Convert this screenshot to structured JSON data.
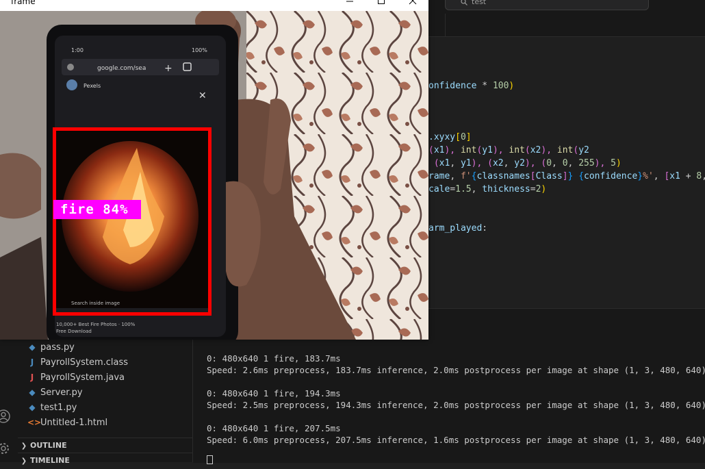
{
  "vscode": {
    "search": {
      "text": "test"
    },
    "code_lines": [
      {
        "segments": [
          {
            "t": "onfidence",
            "c": "var"
          },
          {
            "t": " * ",
            "c": ""
          },
          {
            "t": "100",
            "c": "num"
          },
          {
            "t": ")",
            "c": "brk1"
          }
        ]
      },
      {
        "segments": [
          {
            "t": ".xyxy",
            "c": "var"
          },
          {
            "t": "[",
            "c": "brk1"
          },
          {
            "t": "0",
            "c": "num"
          },
          {
            "t": "]",
            "c": "brk1"
          }
        ]
      },
      {
        "segments": [
          {
            "t": "(",
            "c": "brk2"
          },
          {
            "t": "x1",
            "c": "var"
          },
          {
            "t": "), ",
            "c": "brk2"
          },
          {
            "t": "int",
            "c": "fn"
          },
          {
            "t": "(",
            "c": "brk2"
          },
          {
            "t": "y1",
            "c": "var"
          },
          {
            "t": "), ",
            "c": "brk2"
          },
          {
            "t": "int",
            "c": "fn"
          },
          {
            "t": "(",
            "c": "brk2"
          },
          {
            "t": "x2",
            "c": "var"
          },
          {
            "t": "), ",
            "c": "brk2"
          },
          {
            "t": "int",
            "c": "fn"
          },
          {
            "t": "(",
            "c": "brk2"
          },
          {
            "t": "y2",
            "c": "var"
          }
        ]
      },
      {
        "segments": [
          {
            "t": " (",
            "c": "brk2"
          },
          {
            "t": "x1",
            "c": "var"
          },
          {
            "t": ", ",
            "c": ""
          },
          {
            "t": "y1",
            "c": "var"
          },
          {
            "t": "), ",
            "c": "brk2"
          },
          {
            "t": "(",
            "c": "brk2"
          },
          {
            "t": "x2",
            "c": "var"
          },
          {
            "t": ", ",
            "c": ""
          },
          {
            "t": "y2",
            "c": "var"
          },
          {
            "t": "), ",
            "c": "brk2"
          },
          {
            "t": "(",
            "c": "brk2"
          },
          {
            "t": "0",
            "c": "num"
          },
          {
            "t": ", ",
            "c": ""
          },
          {
            "t": "0",
            "c": "num"
          },
          {
            "t": ", ",
            "c": ""
          },
          {
            "t": "255",
            "c": "num"
          },
          {
            "t": "), ",
            "c": "brk2"
          },
          {
            "t": "5",
            "c": "num"
          },
          {
            "t": ")",
            "c": "brk1"
          }
        ]
      },
      {
        "segments": [
          {
            "t": "rame",
            "c": "var"
          },
          {
            "t": ", ",
            "c": ""
          },
          {
            "t": "f'",
            "c": "str"
          },
          {
            "t": "{",
            "c": "brk3"
          },
          {
            "t": "classnames",
            "c": "var"
          },
          {
            "t": "[",
            "c": "brk2"
          },
          {
            "t": "Class",
            "c": "var"
          },
          {
            "t": "]",
            "c": "brk2"
          },
          {
            "t": "}",
            "c": "brk3"
          },
          {
            "t": " ",
            "c": "str"
          },
          {
            "t": "{",
            "c": "brk3"
          },
          {
            "t": "confidence",
            "c": "var"
          },
          {
            "t": "}",
            "c": "brk3"
          },
          {
            "t": "%'",
            "c": "str"
          },
          {
            "t": ", ",
            "c": ""
          },
          {
            "t": "[",
            "c": "brk2"
          },
          {
            "t": "x1",
            "c": "var"
          },
          {
            "t": " + ",
            "c": ""
          },
          {
            "t": "8",
            "c": "num"
          },
          {
            "t": ",",
            "c": ""
          }
        ]
      },
      {
        "segments": [
          {
            "t": "cale",
            "c": "var"
          },
          {
            "t": "=",
            "c": ""
          },
          {
            "t": "1.5",
            "c": "num"
          },
          {
            "t": ", ",
            "c": ""
          },
          {
            "t": "thickness",
            "c": "var"
          },
          {
            "t": "=",
            "c": ""
          },
          {
            "t": "2",
            "c": "num"
          },
          {
            "t": ")",
            "c": "brk1"
          }
        ]
      },
      {
        "segments": [
          {
            "t": "arm_played",
            "c": "var"
          },
          {
            "t": ":",
            "c": ""
          }
        ]
      }
    ],
    "explorer": {
      "files": [
        {
          "name": "pass.py",
          "icon": "python-file-icon",
          "glyph": "◆",
          "color": "#4b8bbe"
        },
        {
          "name": "PayrollSystem.class",
          "icon": "java-class-file-icon",
          "glyph": "J",
          "color": "#4b8bbe"
        },
        {
          "name": "PayrollSystem.java",
          "icon": "java-file-icon",
          "glyph": "J",
          "color": "#e05252"
        },
        {
          "name": "Server.py",
          "icon": "python-file-icon",
          "glyph": "◆",
          "color": "#4b8bbe"
        },
        {
          "name": "test1.py",
          "icon": "python-file-icon",
          "glyph": "◆",
          "color": "#4b8bbe"
        },
        {
          "name": "Untitled-1.html",
          "icon": "html-file-icon",
          "glyph": "<>",
          "color": "#e37933"
        }
      ],
      "outline_label": "OUTLINE",
      "timeline_label": "TIMELINE"
    },
    "terminal_lines": [
      "0: 480x640 1 fire, 183.7ms",
      "Speed: 2.6ms preprocess, 183.7ms inference, 2.0ms postprocess per image at shape (1, 3, 480, 640)",
      "",
      "0: 480x640 1 fire, 194.3ms",
      "Speed: 2.5ms preprocess, 194.3ms inference, 2.0ms postprocess per image at shape (1, 3, 480, 640)",
      "",
      "0: 480x640 1 fire, 207.5ms",
      "Speed: 6.0ms preprocess, 207.5ms inference, 1.6ms postprocess per image at shape (1, 3, 480, 640)"
    ]
  },
  "frame_window": {
    "title": "frame",
    "detection": {
      "label": "fire 84%",
      "box_color": "#ff0000",
      "label_bg": "#ff00ff"
    },
    "phone": {
      "status_time": "1:00",
      "battery": "100%",
      "url": "google.com/sea",
      "tab_title": "Pexels",
      "caption": "Search inside image",
      "footer_line1": "10,000+ Best Fire Photos · 100%",
      "footer_line2": "Free Download"
    }
  }
}
